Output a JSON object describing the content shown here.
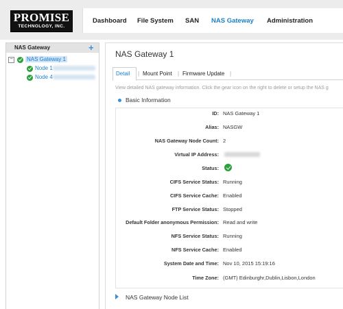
{
  "logo": {
    "line1": "PROMISE",
    "line2": "TECHNOLOGY, INC."
  },
  "nav": [
    {
      "label": "Dashboard"
    },
    {
      "label": "File System"
    },
    {
      "label": "SAN"
    },
    {
      "label": "NAS Gateway"
    },
    {
      "label": "Administration"
    }
  ],
  "sidebar": {
    "title": "NAS Gateway",
    "add_symbol": "+",
    "toggle_symbol": "−",
    "tree": {
      "root": "NAS Gateway 1",
      "children": [
        "Node 1",
        "Node 4"
      ]
    }
  },
  "main": {
    "title": "NAS Gateway 1",
    "tabs": [
      "Detail",
      "Mount Point",
      "Firmware Update"
    ],
    "tab_separator": "|",
    "info_text": "View detailed NAS gateway information. Click the gear icon on the right to delete or setup the NAS g",
    "section_title": "Basic Information",
    "rows": [
      {
        "label": "ID:",
        "value": "NAS Gateway 1"
      },
      {
        "label": "Alias:",
        "value": "NASGW"
      },
      {
        "label": "NAS Gateway Node Count:",
        "value": "2"
      },
      {
        "label": "Virtual IP Address:",
        "value": ""
      },
      {
        "label": "Status:",
        "value": ""
      },
      {
        "label": "CIFS Service Status:",
        "value": "Running"
      },
      {
        "label": "CIFS Service Cache:",
        "value": "Enabled"
      },
      {
        "label": "FTP Service Status:",
        "value": "Stopped"
      },
      {
        "label": "Default Folder anonymous Permission:",
        "value": "Read and write"
      },
      {
        "label": "NFS Service Status:",
        "value": "Running"
      },
      {
        "label": "NFS Service Cache:",
        "value": "Enabled"
      },
      {
        "label": "System Date and Time:",
        "value": "Nov 10, 2015 15:19:16"
      },
      {
        "label": "Time Zone:",
        "value": "(GMT) Edinburghr,Dublin,Lisbon,London"
      }
    ],
    "node_list_title": "NAS Gateway Node List"
  },
  "colors": {
    "accent": "#1a80c8",
    "ok": "#2aa13a"
  }
}
